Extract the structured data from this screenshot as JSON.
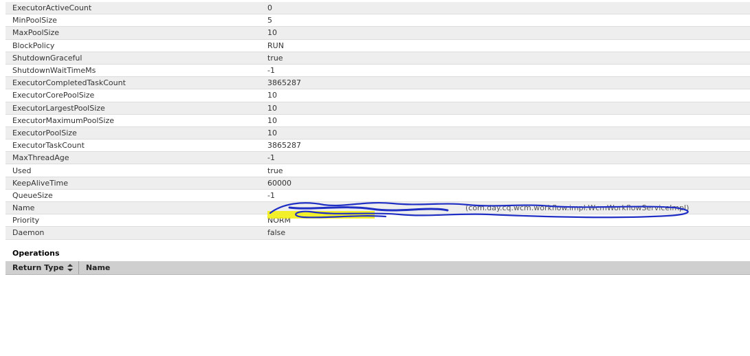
{
  "attributes": [
    {
      "name": "ExecutorActiveCount",
      "value": "0"
    },
    {
      "name": "MinPoolSize",
      "value": "5"
    },
    {
      "name": "MaxPoolSize",
      "value": "10"
    },
    {
      "name": "BlockPolicy",
      "value": "RUN"
    },
    {
      "name": "ShutdownGraceful",
      "value": "true"
    },
    {
      "name": "ShutdownWaitTimeMs",
      "value": "-1"
    },
    {
      "name": "ExecutorCompletedTaskCount",
      "value": "3865287"
    },
    {
      "name": "ExecutorCorePoolSize",
      "value": "10"
    },
    {
      "name": "ExecutorLargestPoolSize",
      "value": "10"
    },
    {
      "name": "ExecutorMaximumPoolSize",
      "value": "10"
    },
    {
      "name": "ExecutorPoolSize",
      "value": "10"
    },
    {
      "name": "ExecutorTaskCount",
      "value": "3865287"
    },
    {
      "name": "MaxThreadAge",
      "value": "-1"
    },
    {
      "name": "Used",
      "value": "true"
    },
    {
      "name": "KeepAliveTime",
      "value": "60000"
    },
    {
      "name": "QueueSize",
      "value": "-1"
    },
    {
      "name": "Name",
      "value": "(com.day.cq.wcm.workflow.impl.WcmWorkflowServiceImpl)"
    },
    {
      "name": "Priority",
      "value": "NORM"
    },
    {
      "name": "Daemon",
      "value": "false"
    }
  ],
  "operations": {
    "title": "Operations",
    "columns": [
      {
        "label": "Return Type"
      },
      {
        "label": "Name"
      }
    ]
  },
  "colors": {
    "row_even": "#eeeeee",
    "header_bg": "#cfcfcf",
    "redaction_blue": "#1f2fc4",
    "redaction_yellow": "#f2ef14"
  }
}
